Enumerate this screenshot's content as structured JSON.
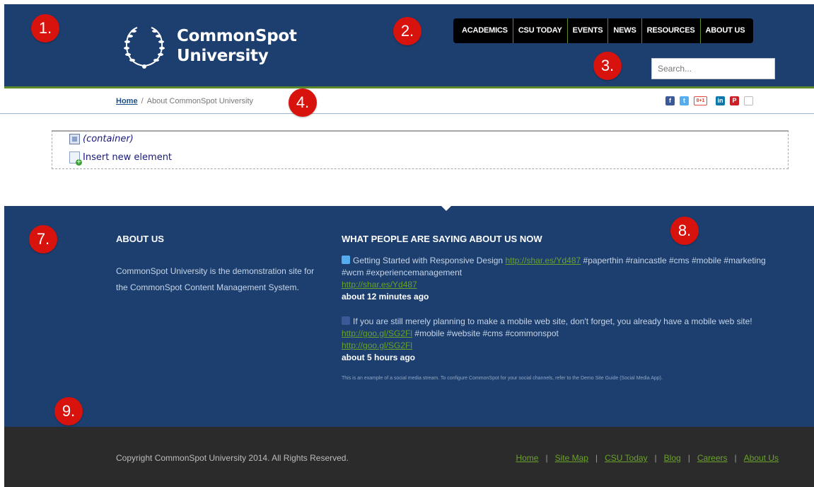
{
  "header": {
    "logo_line1": "CommonSpot",
    "logo_line2": "University",
    "nav": [
      "ACADEMICS",
      "CSU TODAY",
      "EVENTS",
      "NEWS",
      "RESOURCES",
      "ABOUT US"
    ],
    "search_placeholder": "Search..."
  },
  "callouts": [
    "1.",
    "2.",
    "3.",
    "4.",
    "7.",
    "8.",
    "9."
  ],
  "breadcrumb": {
    "home": "Home",
    "separator": "/",
    "current": "About CommonSpot University"
  },
  "social_icons": [
    "facebook-icon",
    "twitter-icon",
    "google-plus-icon",
    "linkedin-icon",
    "pinterest-icon",
    "email-icon"
  ],
  "social_labels": {
    "facebook": "f",
    "twitter": "t",
    "google_plus": "8+1",
    "linkedin": "in",
    "pinterest": "P"
  },
  "editor": {
    "container_label": "(container)",
    "insert_label": "Insert new element"
  },
  "footer": {
    "about_heading": "ABOUT US",
    "about_text": "CommonSpot University is the demonstration site for the CommonSpot Content Management System.",
    "saying_heading": "WHAT PEOPLE ARE SAYING ABOUT US NOW",
    "tweets": [
      {
        "text_before": "Getting Started with Responsive Design",
        "link1": "http://shar.es/Yd487",
        "text_after": "#paperthin #raincastle #cms #mobile #marketing #wcm #experiencemanagement",
        "link2": "http://shar.es/Yd487",
        "time": "about 12 minutes ago"
      },
      {
        "text_before": "If you are still merely planning to make a mobile web site, don't forget, you already have a mobile web site!",
        "link1": "http://goo.gl/SG2Fl",
        "text_after": "#mobile #website #cms #commonspot",
        "link2": "http://goo.gl/SG2Fl",
        "time": "about 5 hours ago"
      }
    ],
    "disclaimer": "This is an example of a social media stream. To configure CommonSpot for your social channels, refer to the Demo Site Guide (Social Media App).",
    "copyright": "Copyright CommonSpot University 2014. All Rights Reserved.",
    "links": [
      "Home",
      "Site Map",
      "CSU Today",
      "Blog",
      "Careers",
      "About Us"
    ],
    "link_separator": "|"
  },
  "colors": {
    "header_blue": "#1c3f70",
    "accent_green": "#5a8a2a",
    "link_green": "#6aa12a",
    "callout_red": "#d8120c",
    "footer_dark": "#2b2b2b"
  }
}
